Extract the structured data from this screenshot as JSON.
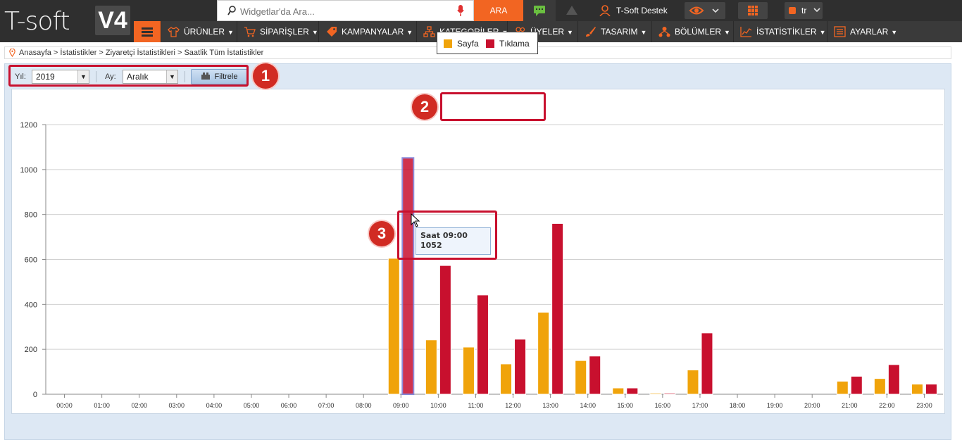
{
  "app": {
    "logo_text": "T-soft",
    "logo_badge": "V4"
  },
  "topbar": {
    "search_placeholder": "Widgetlar'da Ara...",
    "search_button": "ARA",
    "user_label": "T-Soft Destek",
    "language": "tr"
  },
  "nav": {
    "items": [
      {
        "label": "ÜRÜNLER"
      },
      {
        "label": "SİPARİŞLER"
      },
      {
        "label": "KAMPANYALAR"
      },
      {
        "label": "KATEGORİLER"
      },
      {
        "label": "ÜYELER"
      },
      {
        "label": "TASARIM"
      },
      {
        "label": "BÖLÜMLER"
      },
      {
        "label": "İSTATİSTİKLER"
      },
      {
        "label": "AYARLAR"
      }
    ]
  },
  "breadcrumb": "Anasayfa > İstatistikler > Ziyaretçi İstatistikleri > Saatlik Tüm İstatistikler",
  "filters": {
    "year_label": "Yıl:",
    "year_value": "2019",
    "month_label": "Ay:",
    "month_value": "Aralık",
    "filter_button": "Filtrele"
  },
  "annotations": [
    "1",
    "2",
    "3"
  ],
  "tooltip": {
    "title": "Saat 09:00",
    "value": "1052"
  },
  "colors": {
    "page_series": "#f0a30a",
    "click_series": "#c8102e",
    "accent": "#f26522"
  },
  "chart_data": {
    "type": "bar",
    "categories": [
      "00:00",
      "01:00",
      "02:00",
      "03:00",
      "04:00",
      "05:00",
      "06:00",
      "07:00",
      "08:00",
      "09:00",
      "10:00",
      "11:00",
      "12:00",
      "13:00",
      "14:00",
      "15:00",
      "16:00",
      "17:00",
      "18:00",
      "19:00",
      "20:00",
      "21:00",
      "22:00",
      "23:00"
    ],
    "series": [
      {
        "name": "Sayfa",
        "values": [
          0,
          0,
          0,
          0,
          0,
          0,
          0,
          0,
          0,
          605,
          242,
          210,
          135,
          365,
          150,
          28,
          5,
          108,
          0,
          0,
          0,
          58,
          70,
          45
        ]
      },
      {
        "name": "Tıklama",
        "values": [
          0,
          0,
          0,
          0,
          0,
          0,
          0,
          0,
          0,
          1052,
          573,
          442,
          245,
          760,
          170,
          28,
          5,
          273,
          0,
          0,
          0,
          80,
          132,
          45
        ]
      }
    ],
    "yticks": [
      0,
      200,
      400,
      600,
      800,
      1000,
      1200
    ],
    "ylim": [
      0,
      1200
    ],
    "grid": true,
    "legend_position": "top-center",
    "highlighted": {
      "category": "09:00",
      "series": "Tıklama"
    }
  }
}
